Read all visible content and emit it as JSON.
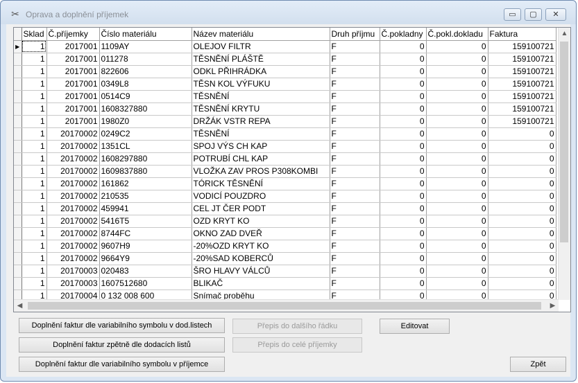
{
  "window": {
    "title": "Oprava a doplnění příjemek",
    "minimize": "▭",
    "restore": "▢",
    "close": "✕"
  },
  "grid": {
    "columns": [
      "Sklad",
      "Č.příjemky",
      "Číslo materiálu",
      "Název materiálu",
      "Druh příjmu",
      "Č.pokladny",
      "Č.pokl.dokladu",
      "Faktura"
    ],
    "rows": [
      [
        "1",
        "2017001",
        "1109AY",
        "OLEJOV FILTR",
        "F",
        "0",
        "0",
        "159100721"
      ],
      [
        "1",
        "2017001",
        "011278",
        "TĚSNĚNÍ PLÁŠTĚ",
        "F",
        "0",
        "0",
        "159100721"
      ],
      [
        "1",
        "2017001",
        "822606",
        "ODKL PŘIHRÁDKA",
        "F",
        "0",
        "0",
        "159100721"
      ],
      [
        "1",
        "2017001",
        "0349L8",
        "TĚSN KOL VÝFUKU",
        "F",
        "0",
        "0",
        "159100721"
      ],
      [
        "1",
        "2017001",
        "0514C9",
        "TĚSNĚNÍ",
        "F",
        "0",
        "0",
        "159100721"
      ],
      [
        "1",
        "2017001",
        "1608327880",
        "TĚSNĚNÍ KRYTU",
        "F",
        "0",
        "0",
        "159100721"
      ],
      [
        "1",
        "2017001",
        "1980Z0",
        "DRŽÁK VSTR REPA",
        "F",
        "0",
        "0",
        "159100721"
      ],
      [
        "1",
        "20170002",
        "0249C2",
        "TĚSNĚNÍ",
        "F",
        "0",
        "0",
        "0"
      ],
      [
        "1",
        "20170002",
        "1351CL",
        "SPOJ VÝS CH KAP",
        "F",
        "0",
        "0",
        "0"
      ],
      [
        "1",
        "20170002",
        "1608297880",
        "POTRUBÍ CHL KAP",
        "F",
        "0",
        "0",
        "0"
      ],
      [
        "1",
        "20170002",
        "1609837880",
        "VLOŽKA ZAV PROS P308KOMBI",
        "F",
        "0",
        "0",
        "0"
      ],
      [
        "1",
        "20170002",
        "161862",
        "TÓRICK TĚSNĚNÍ",
        "F",
        "0",
        "0",
        "0"
      ],
      [
        "1",
        "20170002",
        "210535",
        "VODICÍ POUZDRO",
        "F",
        "0",
        "0",
        "0"
      ],
      [
        "1",
        "20170002",
        "459941",
        "CEL JT ČER PODT",
        "F",
        "0",
        "0",
        "0"
      ],
      [
        "1",
        "20170002",
        "5416T5",
        "OZD KRYT KO",
        "F",
        "0",
        "0",
        "0"
      ],
      [
        "1",
        "20170002",
        "8744FC",
        "OKNO ZAD DVEŘ",
        "F",
        "0",
        "0",
        "0"
      ],
      [
        "1",
        "20170002",
        "9607H9",
        "-20%OZD KRYT KO",
        "F",
        "0",
        "0",
        "0"
      ],
      [
        "1",
        "20170002",
        "9664Y9",
        "-20%SAD KOBERCŮ",
        "F",
        "0",
        "0",
        "0"
      ],
      [
        "1",
        "20170003",
        "020483",
        "ŠRO HLAVY VÁLCŮ",
        "F",
        "0",
        "0",
        "0"
      ],
      [
        "1",
        "20170003",
        "1607512680",
        "BLIKAČ",
        "F",
        "0",
        "0",
        "0"
      ],
      [
        "1",
        "20170004",
        "0 132 008 600",
        "Snímač proběhu",
        "F",
        "0",
        "0",
        "0"
      ]
    ]
  },
  "buttons": {
    "doplneni_vs_dod": "Doplnění faktur dle variabilního symbolu v dod.listech",
    "doplneni_zpetne": "Doplnění faktur zpětně dle dodacích listů",
    "doplneni_vs_prijemce": "Doplnění faktur dle variabilního symbolu v příjemce",
    "prepis_dalsiho": "Přepis do dalšího řádku",
    "prepis_cele": "Přepis do celé příjemky",
    "editovat": "Editovat",
    "zpet": "Zpět"
  }
}
